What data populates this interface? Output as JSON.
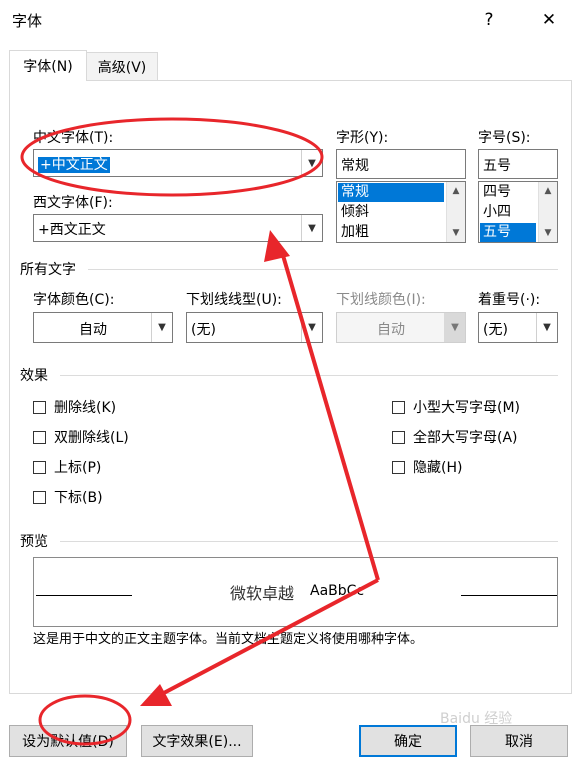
{
  "window": {
    "title": "字体",
    "help": "?",
    "close": "✕"
  },
  "tabs": [
    {
      "label": "字体(N)"
    },
    {
      "label": "高级(V)"
    }
  ],
  "font": {
    "chinese_label": "中文字体(T):",
    "chinese_value": "+中文正文",
    "western_label": "西文字体(F):",
    "western_value": "+西文正文",
    "style_label": "字形(Y):",
    "style_value": "常规",
    "style_options": [
      "常规",
      "倾斜",
      "加粗"
    ],
    "size_label": "字号(S):",
    "size_value": "五号",
    "size_options": [
      "四号",
      "小四",
      "五号"
    ]
  },
  "all_text": {
    "title": "所有文字",
    "font_color_label": "字体颜色(C):",
    "font_color_value": "自动",
    "underline_style_label": "下划线线型(U):",
    "underline_style_value": "(无)",
    "underline_color_label": "下划线颜色(I):",
    "underline_color_value": "自动",
    "emphasis_label": "着重号(·):",
    "emphasis_value": "(无)"
  },
  "effects": {
    "title": "效果",
    "left": [
      "删除线(K)",
      "双删除线(L)",
      "上标(P)",
      "下标(B)"
    ],
    "right": [
      "小型大写字母(M)",
      "全部大写字母(A)",
      "隐藏(H)"
    ]
  },
  "preview": {
    "title": "预览",
    "sample_cn": "微软卓越",
    "sample_en": "AaBbCc",
    "note": "这是用于中文的正文主题字体。当前文档主题定义将使用哪种字体。"
  },
  "buttons": {
    "set_default": "设为默认值(D)",
    "text_effects": "文字效果(E)...",
    "ok": "确定",
    "cancel": "取消"
  },
  "watermark": "Baidu 经验",
  "colors": {
    "accent": "#0078d7",
    "annotation": "#e8262b"
  }
}
